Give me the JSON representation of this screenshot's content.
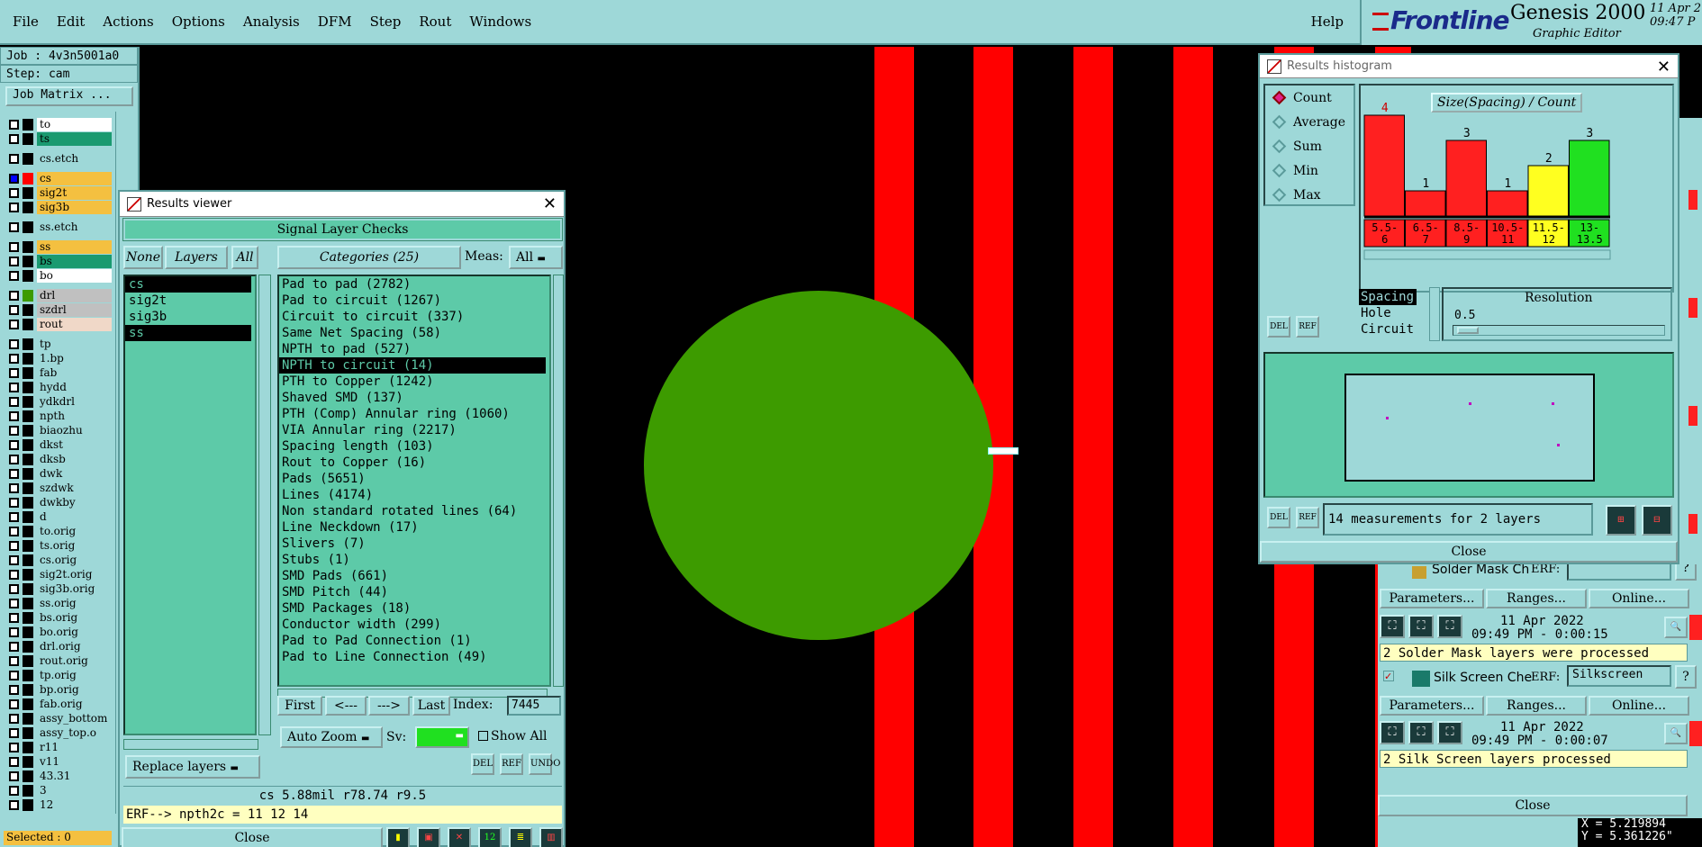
{
  "menu": {
    "items": [
      "File",
      "Edit",
      "Actions",
      "Options",
      "Analysis",
      "DFM",
      "Step",
      "Rout",
      "Windows"
    ],
    "help": "Help"
  },
  "logo": {
    "brand": "Frontline",
    "product": "Genesis 2000",
    "subtitle": "Graphic Editor",
    "date": "11 Apr 2",
    "time": "09:47 P"
  },
  "job": {
    "job": "Job : 4v3n5001a0",
    "step": "Step: cam",
    "matrix_button": "Job Matrix ..."
  },
  "layers": [
    {
      "name": "to",
      "color": "#ffffff",
      "swatch": "#000000"
    },
    {
      "name": "ts",
      "color": "#1a9a70",
      "swatch": "#000000"
    },
    {
      "name": "cs.etch",
      "color": "#9ed8d8",
      "swatch": "#000000",
      "gap": true
    },
    {
      "name": "cs",
      "color": "#f4c040",
      "swatch": "#ff0000",
      "gap": true,
      "checked": true
    },
    {
      "name": "sig2t",
      "color": "#f4c040",
      "swatch": "#000000"
    },
    {
      "name": "sig3b",
      "color": "#f4c040",
      "swatch": "#000000"
    },
    {
      "name": "ss.etch",
      "color": "#9ed8d8",
      "swatch": "#000000",
      "gap": true
    },
    {
      "name": "ss",
      "color": "#f4c040",
      "swatch": "#000000",
      "gap": true
    },
    {
      "name": "bs",
      "color": "#1a9a70",
      "swatch": "#000000"
    },
    {
      "name": "bo",
      "color": "#ffffff",
      "swatch": "#000000"
    },
    {
      "name": "drl",
      "color": "#c0c0c0",
      "swatch": "#3d9b00",
      "gap": true
    },
    {
      "name": "szdrl",
      "color": "#c0c0c0",
      "swatch": "#000000"
    },
    {
      "name": "rout",
      "color": "#f0d8c8",
      "swatch": "#000000"
    },
    {
      "name": "tp",
      "color": "#9ed8d8",
      "swatch": "#000000",
      "gap": true
    },
    {
      "name": "1.bp",
      "color": "#9ed8d8",
      "swatch": "#000000"
    },
    {
      "name": "fab",
      "color": "#9ed8d8",
      "swatch": "#000000"
    },
    {
      "name": "hydd",
      "color": "#9ed8d8",
      "swatch": "#000000"
    },
    {
      "name": "ydkdrl",
      "color": "#9ed8d8",
      "swatch": "#000000"
    },
    {
      "name": "npth",
      "color": "#9ed8d8",
      "swatch": "#000000"
    },
    {
      "name": "biaozhu",
      "color": "#9ed8d8",
      "swatch": "#000000"
    },
    {
      "name": "dkst",
      "color": "#9ed8d8",
      "swatch": "#000000"
    },
    {
      "name": "dksb",
      "color": "#9ed8d8",
      "swatch": "#000000"
    },
    {
      "name": "dwk",
      "color": "#9ed8d8",
      "swatch": "#000000"
    },
    {
      "name": "szdwk",
      "color": "#9ed8d8",
      "swatch": "#000000"
    },
    {
      "name": "dwkby",
      "color": "#9ed8d8",
      "swatch": "#000000"
    },
    {
      "name": "d",
      "color": "#9ed8d8",
      "swatch": "#000000"
    },
    {
      "name": "to.orig",
      "color": "#9ed8d8",
      "swatch": "#000000"
    },
    {
      "name": "ts.orig",
      "color": "#9ed8d8",
      "swatch": "#000000"
    },
    {
      "name": "cs.orig",
      "color": "#9ed8d8",
      "swatch": "#000000"
    },
    {
      "name": "sig2t.orig",
      "color": "#9ed8d8",
      "swatch": "#000000"
    },
    {
      "name": "sig3b.orig",
      "color": "#9ed8d8",
      "swatch": "#000000"
    },
    {
      "name": "ss.orig",
      "color": "#9ed8d8",
      "swatch": "#000000"
    },
    {
      "name": "bs.orig",
      "color": "#9ed8d8",
      "swatch": "#000000"
    },
    {
      "name": "bo.orig",
      "color": "#9ed8d8",
      "swatch": "#000000"
    },
    {
      "name": "drl.orig",
      "color": "#9ed8d8",
      "swatch": "#000000"
    },
    {
      "name": "rout.orig",
      "color": "#9ed8d8",
      "swatch": "#000000"
    },
    {
      "name": "tp.orig",
      "color": "#9ed8d8",
      "swatch": "#000000"
    },
    {
      "name": "bp.orig",
      "color": "#9ed8d8",
      "swatch": "#000000"
    },
    {
      "name": "fab.orig",
      "color": "#9ed8d8",
      "swatch": "#000000"
    },
    {
      "name": "assy_bottom",
      "color": "#9ed8d8",
      "swatch": "#000000"
    },
    {
      "name": "assy_top.o",
      "color": "#9ed8d8",
      "swatch": "#000000"
    },
    {
      "name": "r11",
      "color": "#9ed8d8",
      "swatch": "#000000"
    },
    {
      "name": "v11",
      "color": "#9ed8d8",
      "swatch": "#000000"
    },
    {
      "name": "43.31",
      "color": "#9ed8d8",
      "swatch": "#000000"
    },
    {
      "name": "3",
      "color": "#9ed8d8",
      "swatch": "#000000"
    },
    {
      "name": "12",
      "color": "#9ed8d8",
      "swatch": "#000000"
    }
  ],
  "selected_count": "Selected : 0",
  "results_viewer": {
    "title": "Results viewer",
    "section": "Signal Layer Checks",
    "none_btn": "None",
    "layers_btn": "Layers",
    "all_btn": "All",
    "categories_btn": "Categories (25)",
    "meas_label": "Meas:",
    "meas_value": "All",
    "layer_items": [
      {
        "name": "cs",
        "selected": true
      },
      {
        "name": "sig2t",
        "selected": false
      },
      {
        "name": "sig3b",
        "selected": false
      },
      {
        "name": "ss",
        "selected": true
      }
    ],
    "categories": [
      "Pad to pad (2782)",
      "Pad to circuit (1267)",
      "Circuit to circuit (337)",
      "Same Net Spacing (58)",
      "NPTH to pad (527)",
      "NPTH to circuit (14)",
      "PTH to Copper (1242)",
      "Shaved SMD (137)",
      "PTH (Comp) Annular ring (1060)",
      "VIA Annular ring (2217)",
      "Spacing length (103)",
      "Rout to Copper (16)",
      "Pads (5651)",
      "Lines (4174)",
      "Non standard rotated lines (64)",
      "Line Neckdown (17)",
      "Slivers (7)",
      "Stubs (1)",
      "SMD Pads (661)",
      "SMD Pitch (44)",
      "SMD Packages (18)",
      "Conductor width (299)",
      "Pad to Pad Connection (1)",
      "Pad to Line Connection (49)"
    ],
    "selected_category": "NPTH to circuit (14)",
    "first_btn": "First",
    "prev_btn": "<---",
    "next_btn": "--->",
    "last_btn": "Last",
    "index_label": "Index:",
    "index_value": "7445",
    "zoom_value": "Auto Zoom",
    "sv_label": "Sv:",
    "show_all": "Show All",
    "replace_layers": "Replace layers",
    "status_line": "cs 5.88mil  r78.74  r9.5",
    "erf_line": "ERF--> npth2c = 11 12 14",
    "close": "Close"
  },
  "histogram": {
    "title": "Results histogram",
    "modes": [
      {
        "label": "Count",
        "active": true
      },
      {
        "label": "Average",
        "active": false
      },
      {
        "label": "Sum",
        "active": false
      },
      {
        "label": "Min",
        "active": false
      },
      {
        "label": "Max",
        "active": false
      }
    ],
    "chart_title": "Size(Spacing) / Count",
    "types": [
      "Spacing",
      "Hole",
      "Circuit"
    ],
    "resolution_label": "Resolution",
    "resolution_value": "0.5",
    "message": "14 measurements for 2 layers",
    "close": "Close"
  },
  "chart_data": {
    "type": "bar",
    "title": "Size(Spacing) / Count",
    "categories": [
      "5.5-6",
      "6.5-7",
      "8.5-9",
      "10.5-11",
      "11.5-12",
      "13-13.5"
    ],
    "values": [
      4,
      1,
      3,
      1,
      2,
      3
    ],
    "colors": [
      "#ff2020",
      "#ff2020",
      "#ff2020",
      "#ff2020",
      "#ffff20",
      "#20e020"
    ],
    "category_label_lines": [
      [
        "5.5-",
        "6"
      ],
      [
        "6.5-",
        "7"
      ],
      [
        "8.5-",
        "9"
      ],
      [
        "10.5-",
        "11"
      ],
      [
        "11.5-",
        "12"
      ],
      [
        "13-",
        "13.5"
      ]
    ],
    "ylim": [
      0,
      4
    ],
    "xlabel": "",
    "ylabel": ""
  },
  "checks": {
    "partial_name": "Solder Mask Ch",
    "erf": "ERF:",
    "params_btn": "Parameters...",
    "ranges_btn": "Ranges...",
    "online_btn": "Online...",
    "sm_date": "11 Apr 2022",
    "sm_time": "09:49 PM - 0:00:15",
    "sm_status": "2 Solder Mask layers were processed",
    "ss_name": "Silk Screen Che",
    "ss_erf_value": "Silkscreen",
    "ss_date": "11 Apr 2022",
    "ss_time": "09:49 PM - 0:00:07",
    "ss_status": "2 Silk Screen layers processed",
    "close": "Close",
    "help": "?"
  },
  "coords": {
    "x": "X = 5.219894",
    "y": "Y = 5.361226\""
  }
}
